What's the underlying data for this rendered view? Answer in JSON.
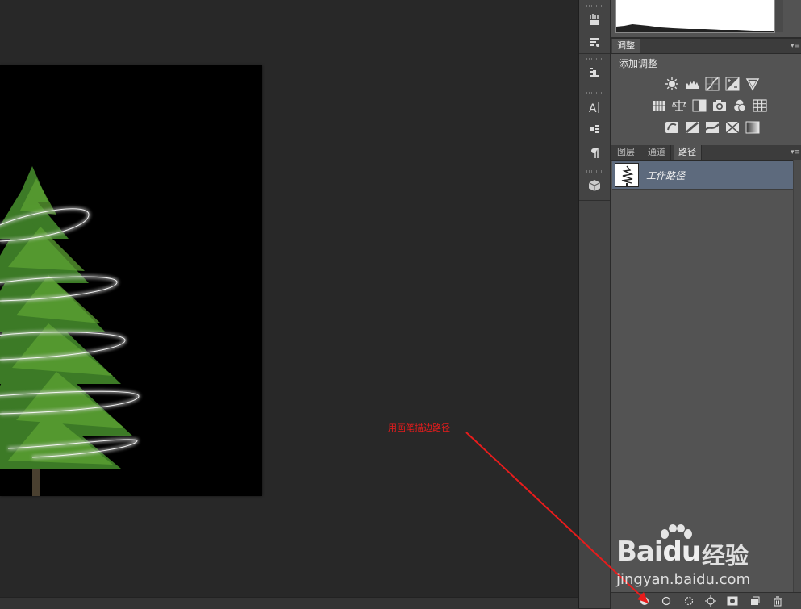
{
  "adjustments_panel": {
    "tab_label": "调整",
    "title": "添加调整",
    "row1_icons": [
      "brightness-contrast-icon",
      "levels-icon",
      "curves-icon",
      "exposure-icon",
      "vibrance-icon"
    ],
    "row2_icons": [
      "hue-saturation-icon",
      "color-balance-icon",
      "black-white-icon",
      "photo-filter-icon",
      "channel-mixer-icon",
      "color-lookup-icon"
    ],
    "row3_icons": [
      "invert-icon",
      "posterize-icon",
      "threshold-icon",
      "selective-color-icon",
      "gradient-map-icon"
    ]
  },
  "paths_panel": {
    "tabs": [
      {
        "label": "图层",
        "active": false
      },
      {
        "label": "通道",
        "active": false
      },
      {
        "label": "路径",
        "active": true
      }
    ],
    "path_item": "工作路径",
    "footer_icons": [
      "fill-path-icon",
      "stroke-path-icon",
      "load-selection-icon",
      "make-work-path-icon",
      "add-mask-icon",
      "new-path-icon",
      "delete-path-icon"
    ]
  },
  "annotation": {
    "text": "用画笔描边路径",
    "color": "#e81c1c"
  },
  "watermark": {
    "logo_left": "Bai",
    "logo_right": "du",
    "logo_cn": "经验",
    "url": "jingyan.baidu.com"
  },
  "colors": {
    "workspace_bg": "#282828",
    "panel_bg": "#535353",
    "selected_row": "#5d6a7d",
    "tree_green": "#3f7d28"
  }
}
